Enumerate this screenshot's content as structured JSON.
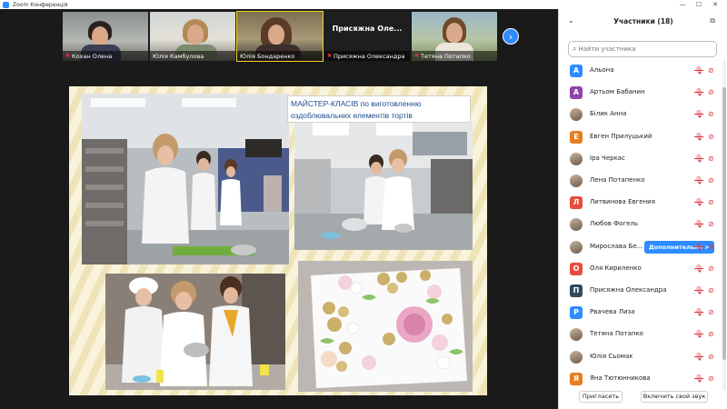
{
  "window": {
    "title": "Zoom Конференція",
    "minimize": "—",
    "maximize": "☐",
    "close": "✕"
  },
  "video_strip": {
    "tiles": [
      {
        "name": "Кохан Олена",
        "muted": true,
        "active": false,
        "mic_icon": "mic-off-icon"
      },
      {
        "name": "Юлія Камбулова",
        "muted": false,
        "active": false,
        "mic_icon": ""
      },
      {
        "name": "Юлія Бондаренко",
        "muted": false,
        "active": true,
        "mic_icon": ""
      },
      {
        "name": "Присяжна Олександра",
        "big_name": "Присяжна  Оле...",
        "muted": true,
        "active": false,
        "mic_icon": "mic-off-icon"
      },
      {
        "name": "Тетяна Потапко",
        "muted": true,
        "active": false,
        "mic_icon": "mic-off-icon"
      }
    ],
    "next_arrow": "›"
  },
  "slide": {
    "caption_line1": "МАЙСТЕР-КЛАСІВ по виготовленню",
    "caption_line2": "оздоблювальних елементів тортів"
  },
  "participants": {
    "title": "Участники (18)",
    "search_placeholder": "Найти участника",
    "more_button": "Дополнительно >",
    "items": [
      {
        "name": "Альона",
        "initial": "А",
        "color": "#2d8cff",
        "photo": false
      },
      {
        "name": "Артьом Бабанин",
        "initial": "А",
        "color": "#8e44ad",
        "photo": false
      },
      {
        "name": "Білик Анна",
        "initial": "",
        "color": "",
        "photo": true
      },
      {
        "name": "Евген Прилуцький",
        "initial": "Е",
        "color": "#e67e22",
        "photo": false
      },
      {
        "name": "Іра Черкас",
        "initial": "",
        "color": "",
        "photo": true
      },
      {
        "name": "Лена Потапенко",
        "initial": "",
        "color": "",
        "photo": true
      },
      {
        "name": "Литвинова Евгения",
        "initial": "Л",
        "color": "#e74c3c",
        "photo": false
      },
      {
        "name": "Любов Фогель",
        "initial": "",
        "color": "",
        "photo": true
      },
      {
        "name": "Мирослава Бе...",
        "initial": "",
        "color": "",
        "photo": true
      },
      {
        "name": "Оля Кириленко",
        "initial": "О",
        "color": "#e74c3c",
        "photo": false
      },
      {
        "name": "Присяжна Олександра",
        "initial": "П",
        "color": "#34495e",
        "photo": false
      },
      {
        "name": "Рвачева Лиза",
        "initial": "Р",
        "color": "#2d8cff",
        "photo": false
      },
      {
        "name": "Тетяна Потапко",
        "initial": "",
        "color": "",
        "photo": true
      },
      {
        "name": "Юлія Сьомак",
        "initial": "",
        "color": "",
        "photo": true
      },
      {
        "name": "Яна Тютюнникова",
        "initial": "Я",
        "color": "#e67e22",
        "photo": false
      }
    ],
    "invite_button": "Пригласить",
    "unmute_button": "Включить свой звук"
  },
  "colors": {
    "accent": "#2d8cff",
    "muted_red": "#e0343f",
    "active_speaker": "#f1d32a"
  }
}
